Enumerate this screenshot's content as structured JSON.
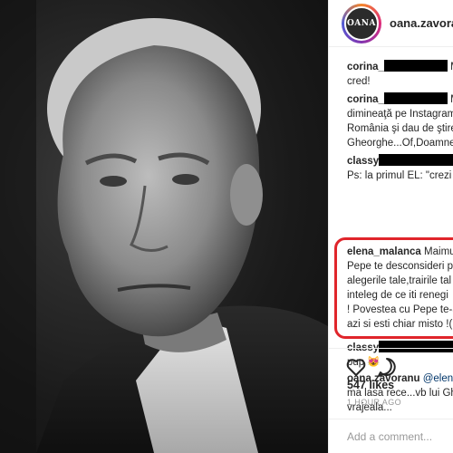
{
  "post": {
    "username": "oana.zavoranu",
    "avatar_text": "OANA",
    "likes": "547 likes",
    "time": "1 HOUR AGO",
    "add_comment_placeholder": "Add a comment..."
  },
  "comments": [
    {
      "user": "corina_",
      "lines": [
        "M",
        "cred!"
      ]
    },
    {
      "user": "corina_",
      "lines": [
        "M",
        "dimineaţă pe Instagram",
        "România şi dau de ştire",
        "Gheorghe...Of,Doamne"
      ]
    },
    {
      "user": "classy",
      "lines": [
        "",
        "Ps: la primul EL: \"crezi c"
      ]
    },
    {
      "user": "elena_malanca",
      "lines": [
        "Maimu",
        "Pepe te desconsideri p",
        "alegerile tale,trairile tal",
        "inteleg de ce iti renegi",
        "! Povestea cu Pepe te-a",
        "azi si esti chiar misto !("
      ]
    },
    {
      "user": "classy",
      "lines": [
        "",
        "pup 😻"
      ]
    },
    {
      "user": "oana.zavoranu",
      "mention": "@elena",
      "lines": [
        "",
        "ma lasa rece...vb lui Gh",
        "vrajeala..."
      ]
    }
  ],
  "icons": [
    "heart-icon",
    "comment-icon"
  ],
  "colors": {
    "highlight": "#e0252b",
    "mention": "#003569",
    "muted": "#999999"
  }
}
